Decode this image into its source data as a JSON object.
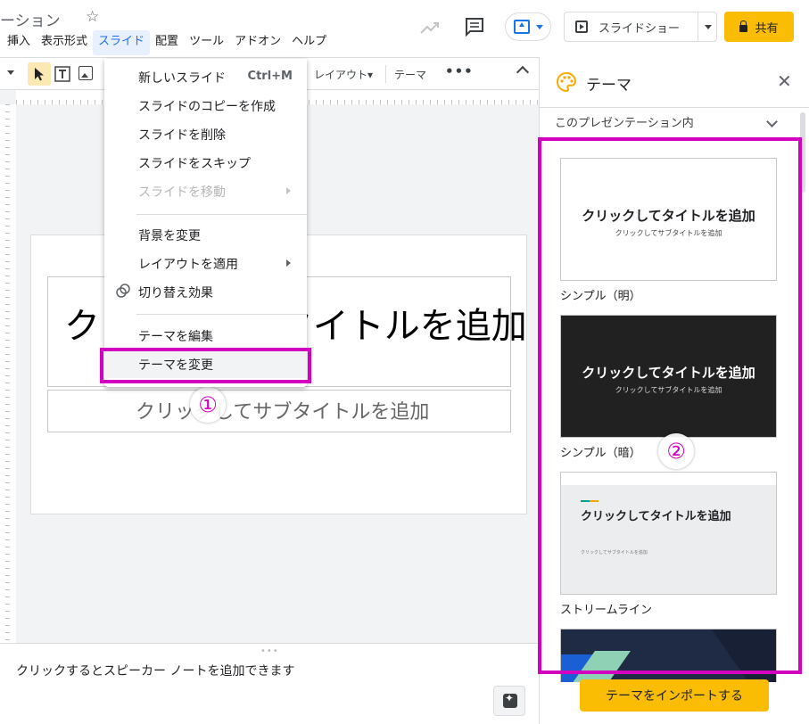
{
  "header": {
    "doc_title": "ーション",
    "star": "☆",
    "menu": [
      "挿入",
      "表示形式",
      "スライド",
      "配置",
      "ツール",
      "アドオン",
      "ヘルプ"
    ],
    "slideshow_label": "スライドショー",
    "share_label": "共有"
  },
  "toolbar": {
    "layout_label": "レイアウト▾",
    "theme_label": "テーマ",
    "more": "•••"
  },
  "slide": {
    "title": "クリックしてタイトルを追加",
    "subtitle": "クリックしてサブタイトルを追加"
  },
  "slide_menu": {
    "items": [
      {
        "label": "新しいスライド",
        "shortcut": "Ctrl+M"
      },
      {
        "label": "スライドのコピーを作成"
      },
      {
        "label": "スライドを削除"
      },
      {
        "label": "スライドをスキップ"
      },
      {
        "label": "スライドを移動",
        "disabled": true,
        "submenu": true
      },
      {
        "label": "背景を変更"
      },
      {
        "label": "レイアウトを適用",
        "submenu": true
      },
      {
        "label": "切り替え効果"
      },
      {
        "label": "テーマを編集"
      },
      {
        "label": "テーマを変更"
      }
    ]
  },
  "annotations": {
    "step1": "①",
    "step2": "②",
    "highlight_color": "#d400c0"
  },
  "notes": {
    "placeholder": "クリックするとスピーカー ノートを追加できます",
    "grip": "•••"
  },
  "theme_panel": {
    "title": "テーマ",
    "close": "✕",
    "scope": "このプレゼンテーション内",
    "themes": [
      {
        "name": "シンプル（明）",
        "preview_title": "クリックしてタイトルを追加",
        "preview_subtitle": "クリックしてサブタイトルを追加"
      },
      {
        "name": "シンプル（暗）",
        "preview_title": "クリックしてタイトルを追加",
        "preview_subtitle": "クリックしてサブタイトルを追加"
      },
      {
        "name": "ストリームライン",
        "preview_title": "クリックしてタイトルを追加",
        "preview_subtitle": "クリックしてサブタイトルを追加"
      }
    ],
    "import_label": "テーマをインポートする"
  },
  "colors": {
    "accent_yellow": "#fbbc04",
    "google_blue": "#1a73e8"
  }
}
